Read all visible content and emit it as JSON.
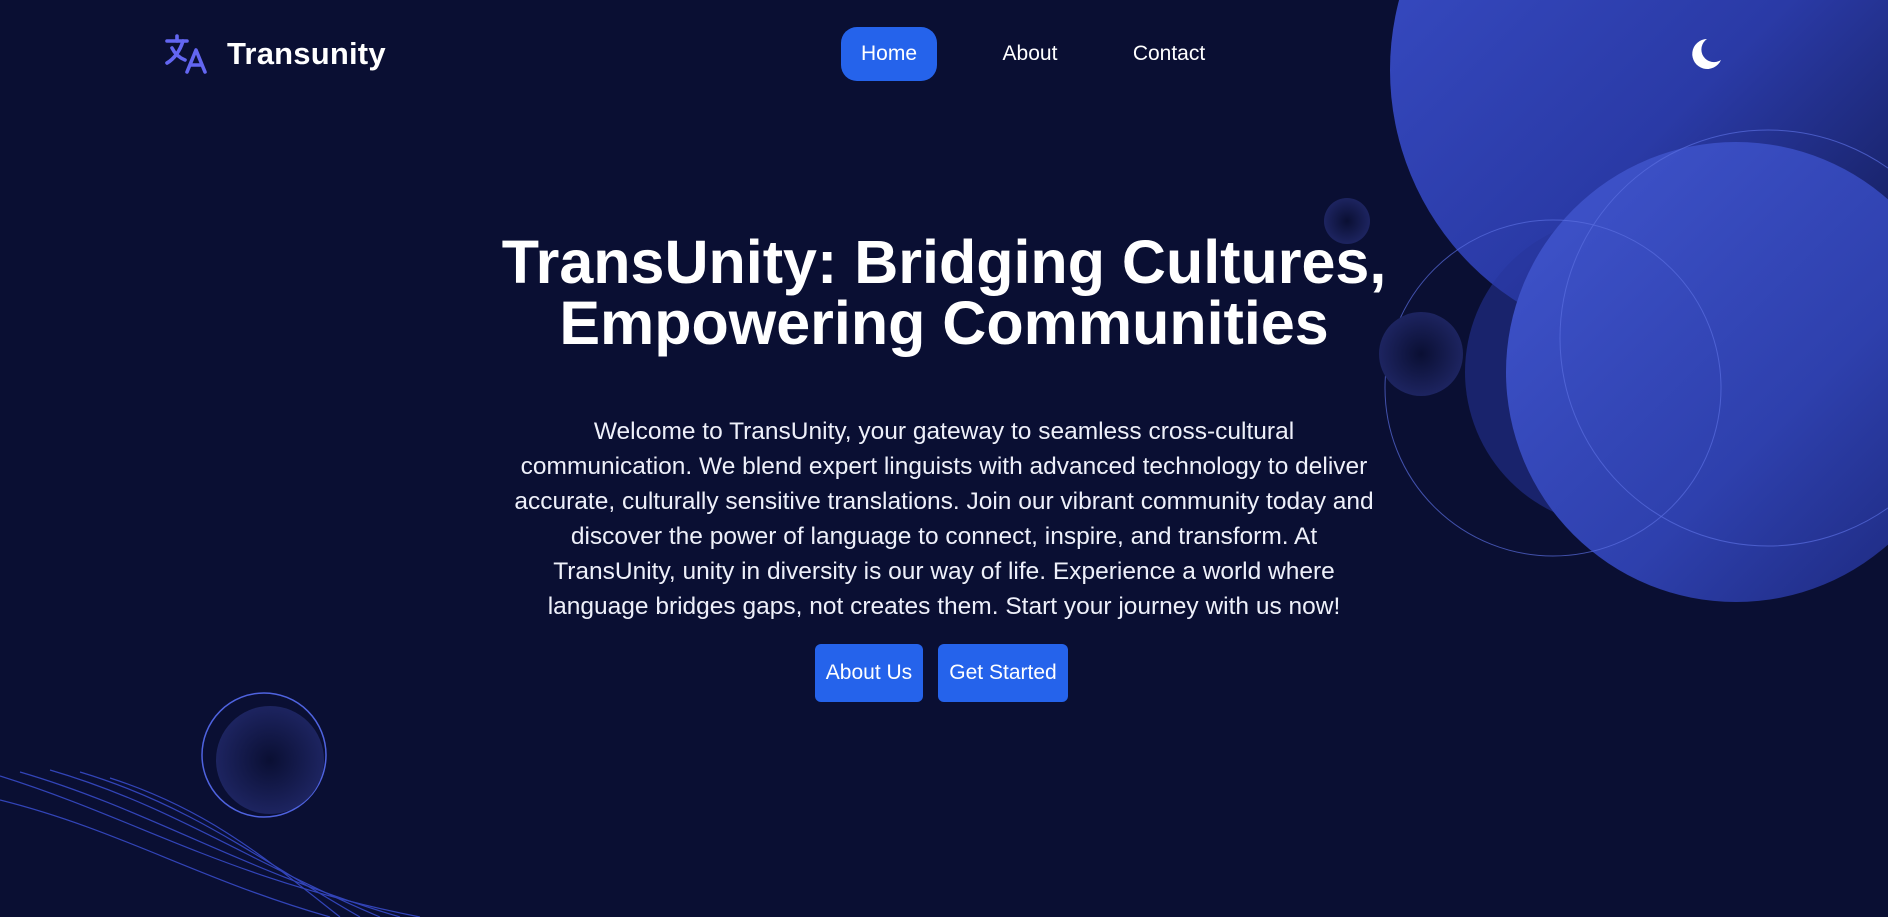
{
  "brand": {
    "name": "Transunity",
    "icon": "translate-icon"
  },
  "nav": {
    "items": [
      {
        "label": "Home",
        "active": true
      },
      {
        "label": "About",
        "active": false
      },
      {
        "label": "Contact",
        "active": false
      }
    ]
  },
  "theme_toggle": {
    "icon": "moon-icon"
  },
  "hero": {
    "title_line1": "TransUnity: Bridging Cultures,",
    "title_line2": "Empowering Communities",
    "paragraph_lines": [
      "Welcome to TransUnity, your gateway to seamless cross-cultural",
      "communication. We blend expert linguists with advanced technology to deliver",
      "accurate, culturally sensitive translations. Join our vibrant community today and",
      "discover the power of language to connect, inspire, and transform. At",
      "TransUnity, unity in diversity is our way of life. Experience a world where",
      "language bridges gaps, not creates them. Start your journey with us now!"
    ],
    "buttons": {
      "about_us": "About Us",
      "get_started": "Get Started"
    }
  },
  "colors": {
    "background": "#0a0f33",
    "accent": "#2563eb",
    "brand_icon": "#6366f1",
    "decor_blue": "#3b4fc4"
  }
}
